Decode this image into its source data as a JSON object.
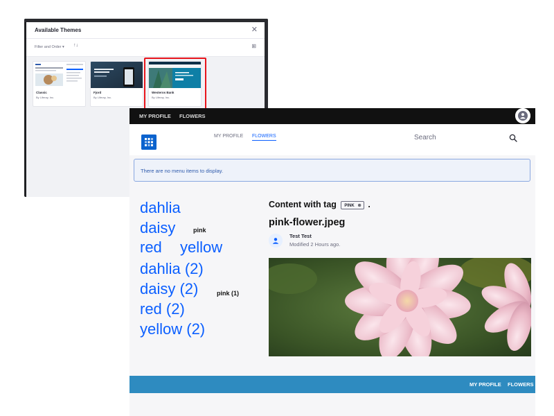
{
  "themes_dialog": {
    "title": "Available Themes",
    "close_glyph": "✕",
    "filter_label": "Filter and Order ▾",
    "sort_glyph": "↑↓",
    "view_glyph": "⊞",
    "themes": [
      {
        "name": "Classic",
        "author": "By Liferay, Inc."
      },
      {
        "name": "Fjord",
        "author": "By Liferay, Inc."
      },
      {
        "name": "Westeros Bank",
        "author": "By Liferay, Inc."
      }
    ],
    "highlight_color": "#e8141b"
  },
  "page": {
    "top_nav": [
      "MY PROFILE",
      "FLOWERS"
    ],
    "main_nav": [
      "MY PROFILE",
      "FLOWERS"
    ],
    "search_placeholder": "Search",
    "menu_alert": "There are no menu items to display.",
    "tag_cloud": [
      "dahlia",
      "daisy",
      "pink",
      "red",
      "yellow"
    ],
    "tag_cloud_counts": [
      "dahlia (2)",
      "daisy (2)",
      "pink (1)",
      "red (2)",
      "yellow (2)"
    ],
    "content_heading": "Content with tag",
    "selected_tag": "PINK",
    "tag_remove_glyph": "⊗",
    "heading_period": ".",
    "asset_title": "pink-flower.jpeg",
    "author": "Test Test",
    "modified": "Modified 2 Hours ago.",
    "footer_nav": [
      "MY PROFILE",
      "FLOWERS"
    ],
    "colors": {
      "accent": "#0b5fff",
      "top_bar": "#111111",
      "footer_bar": "#2e8bc0",
      "alert_bg": "#eef2fa",
      "alert_text": "#2e5aac"
    }
  }
}
